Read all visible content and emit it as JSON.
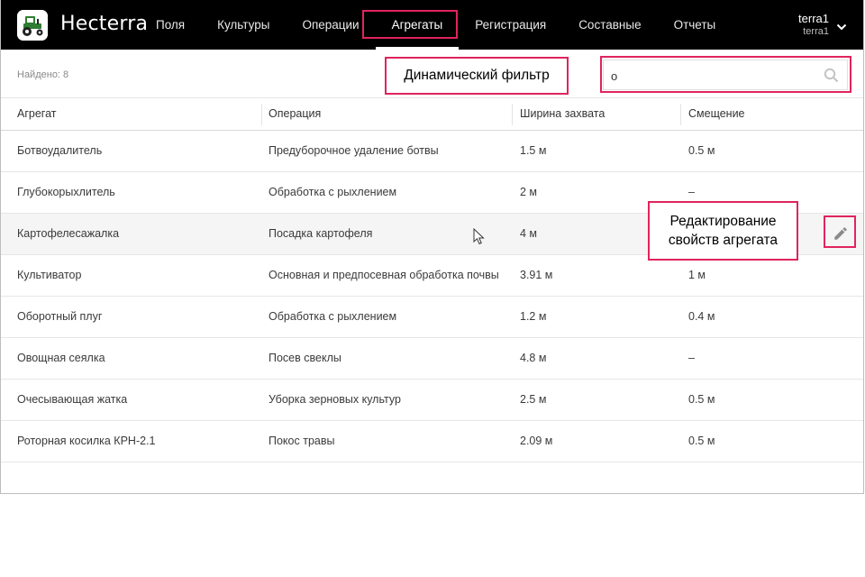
{
  "app": {
    "brand": "Hecterra"
  },
  "nav": [
    {
      "label": "Поля"
    },
    {
      "label": "Культуры"
    },
    {
      "label": "Операции"
    },
    {
      "label": "Агрегаты",
      "active": true
    },
    {
      "label": "Регистрация"
    },
    {
      "label": "Составные"
    },
    {
      "label": "Отчеты"
    }
  ],
  "user": {
    "name": "terra1",
    "account": "terra1"
  },
  "toolbar": {
    "found": "Найдено: 8",
    "search_value": "о"
  },
  "annotations": {
    "filter": "Динамический фильтр",
    "edit_line1": "Редактирование",
    "edit_line2": "свойств агрегата"
  },
  "table": {
    "columns": [
      "Агрегат",
      "Операция",
      "Ширина захвата",
      "Смещение"
    ],
    "rows": [
      {
        "unit": "Ботвоудалитель",
        "operation": "Предуборочное удаление ботвы",
        "width": "1.5 м",
        "offset": "0.5 м"
      },
      {
        "unit": "Глубокорыхлитель",
        "operation": "Обработка с рыхлением",
        "width": "2 м",
        "offset": "–"
      },
      {
        "unit": "Картофелесажалка",
        "operation": "Посадка картофеля",
        "width": "4 м",
        "offset": ""
      },
      {
        "unit": "Культиватор",
        "operation": "Основная и предпосевная обработка почвы",
        "width": "3.91 м",
        "offset": "1 м"
      },
      {
        "unit": "Оборотный плуг",
        "operation": "Обработка с рыхлением",
        "width": "1.2 м",
        "offset": "0.4 м"
      },
      {
        "unit": "Овощная сеялка",
        "operation": "Посев свеклы",
        "width": "4.8 м",
        "offset": "–"
      },
      {
        "unit": "Очесывающая жатка",
        "operation": "Уборка зерновых культур",
        "width": "2.5 м",
        "offset": "0.5 м"
      },
      {
        "unit": "Роторная косилка КРН-2.1",
        "operation": "Покос травы",
        "width": "2.09 м",
        "offset": "0.5 м"
      }
    ]
  },
  "colors": {
    "accent": "#e0245e",
    "header_bg": "#000000",
    "logo_green": "#2e7d32"
  },
  "icons": {
    "logo": "tractor-icon",
    "search": "search-icon",
    "edit": "pencil-icon",
    "dropdown": "chevron-down-icon"
  }
}
